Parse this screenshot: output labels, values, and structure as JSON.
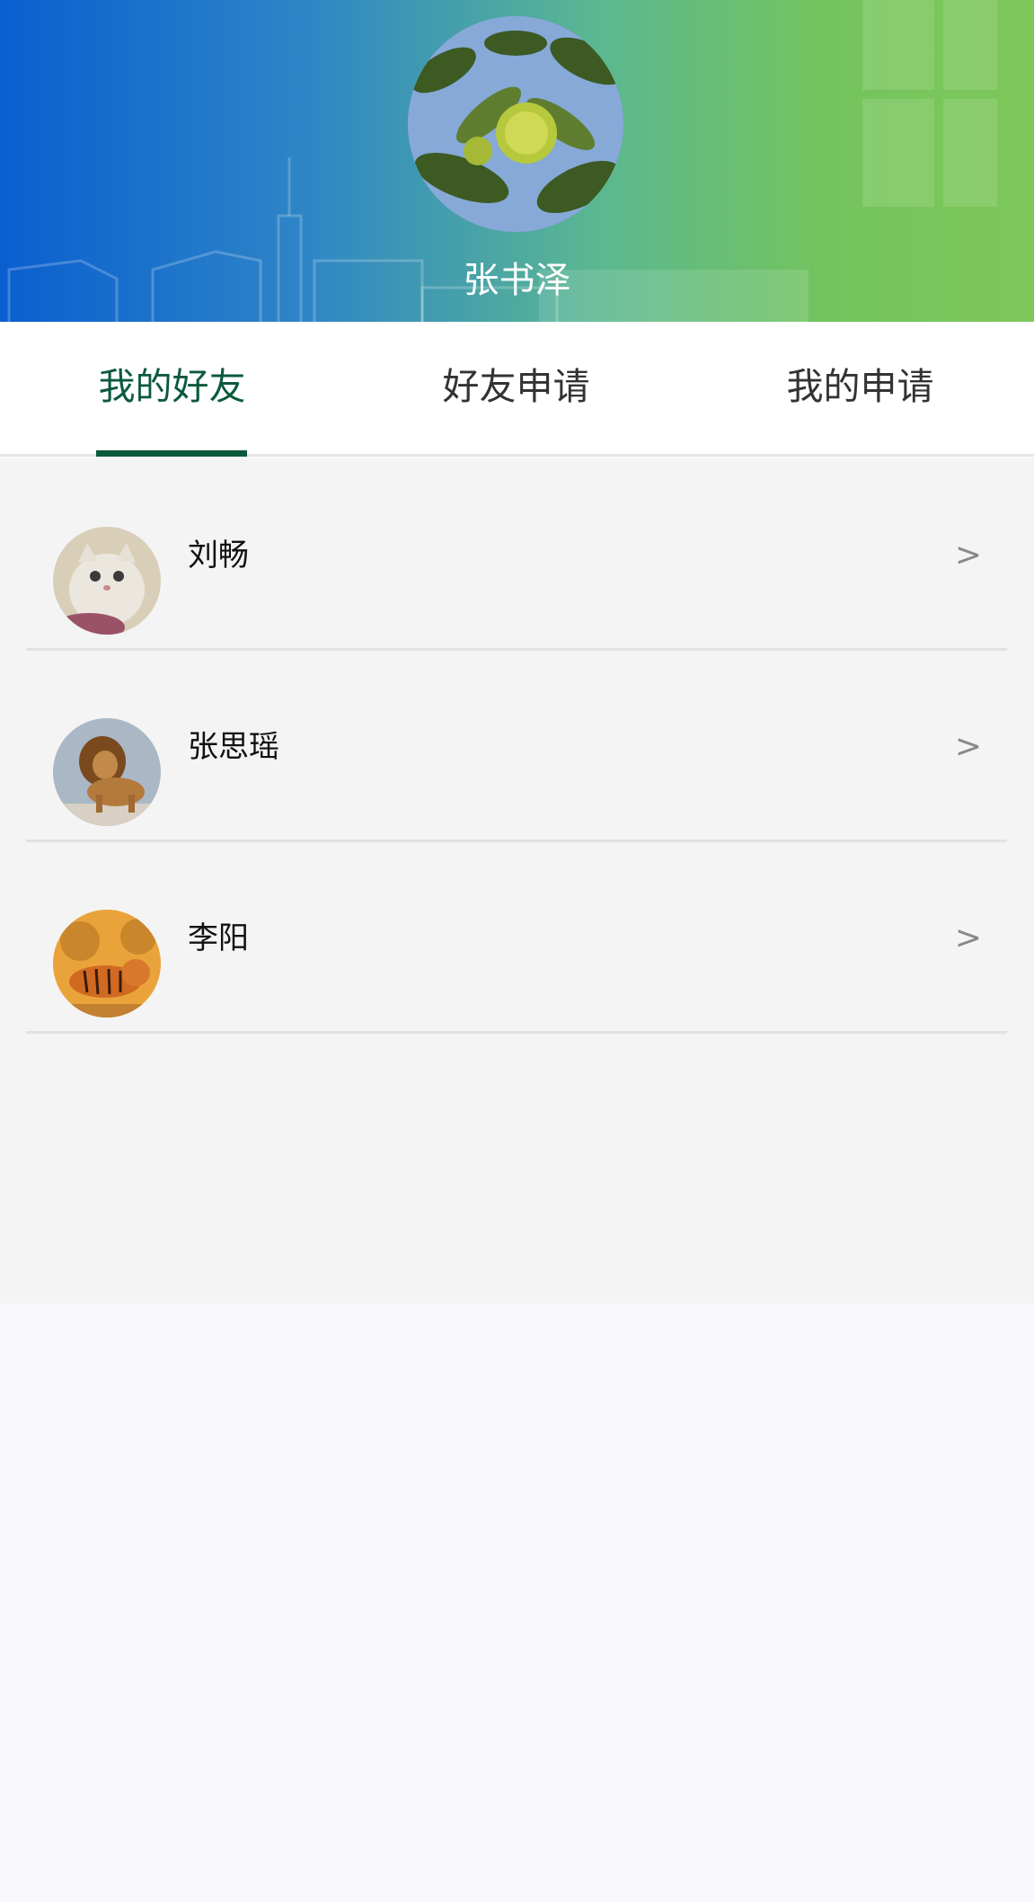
{
  "profile": {
    "user_name": "张书泽",
    "avatar_icon": "chestnut-tree-photo"
  },
  "tabs": [
    {
      "label": "我的好友",
      "active": true
    },
    {
      "label": "好友申请",
      "active": false
    },
    {
      "label": "我的申请",
      "active": false
    }
  ],
  "friends": [
    {
      "name": "刘畅",
      "avatar": "cat-photo",
      "arrow": ">"
    },
    {
      "name": "张思瑶",
      "avatar": "lion-photo",
      "arrow": ">"
    },
    {
      "name": "李阳",
      "avatar": "tiger-photo",
      "arrow": ">"
    }
  ],
  "colors": {
    "accent": "#0c5a3c",
    "header_start": "#0a5fd0",
    "header_end": "#7dc75a"
  }
}
